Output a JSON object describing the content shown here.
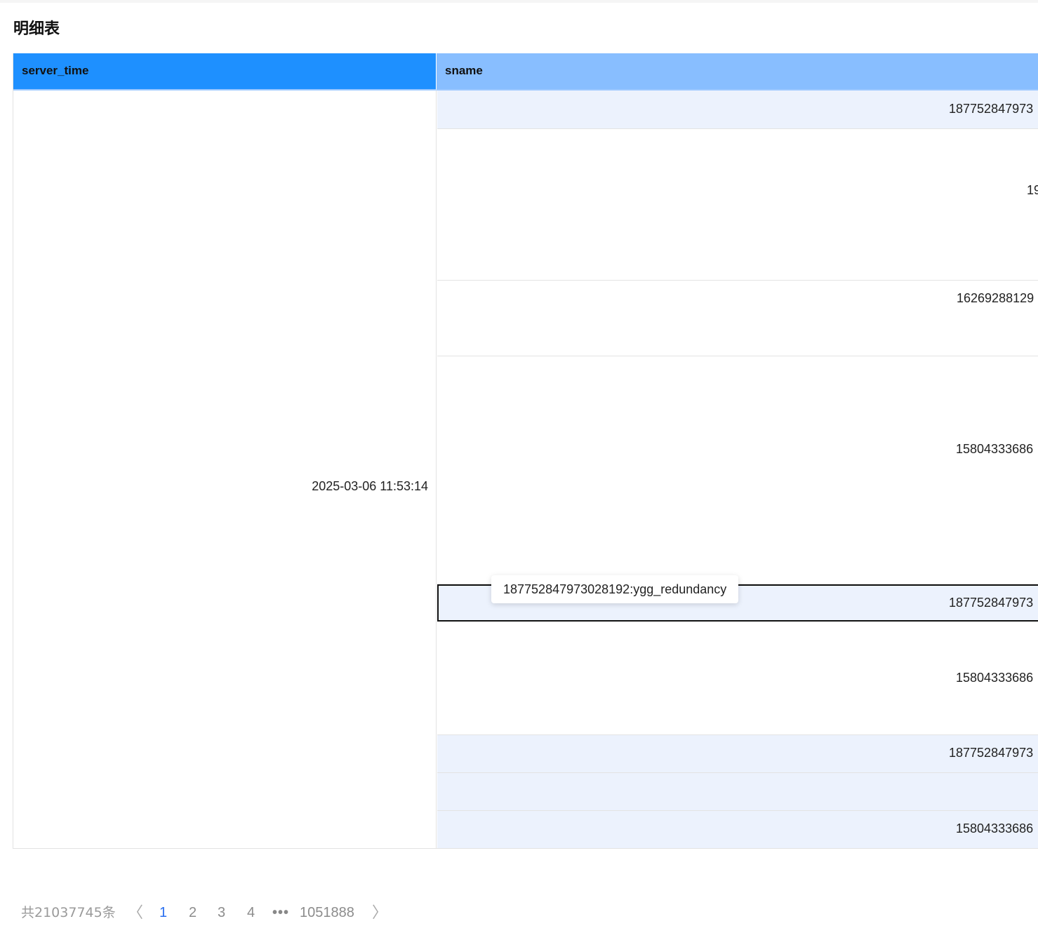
{
  "title": "明细表",
  "table": {
    "columns": [
      "server_time",
      "sname"
    ],
    "server_time_value": "2025-03-06 11:53:14",
    "sname_cells": [
      "187752847973",
      "19",
      "16269288129",
      "15804333686",
      "187752847973",
      "15804333686",
      "187752847973",
      "",
      "15804333686"
    ]
  },
  "tooltip": {
    "text": "187752847973028192:ygg_redundancy"
  },
  "pagination": {
    "total": "共21037745条",
    "prev_icon": "chevron-left-icon",
    "next_icon": "chevron-right-icon",
    "prev_glyph": "〈",
    "next_glyph": "〉",
    "pages": [
      "1",
      "2",
      "3",
      "4"
    ],
    "ellipsis": "•••",
    "last_page": "1051888",
    "active_page": "1"
  },
  "colors": {
    "header_primary": "#1e90ff",
    "header_secondary": "#88beff",
    "row_alt": "#ecf2fd",
    "active_page": "#2a6ff0"
  }
}
